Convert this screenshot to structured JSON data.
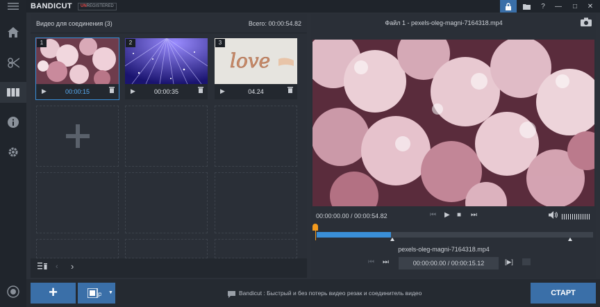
{
  "app": {
    "logo": "BANDICUT",
    "badge_prefix": "UN",
    "badge_rest": "REGISTERED"
  },
  "titlebar": {
    "buttons": [
      "lock-icon",
      "folder-icon",
      "help-icon",
      "minimize-icon",
      "maximize-icon",
      "close-icon"
    ],
    "help_label": "?",
    "minimize_label": "—",
    "maximize_label": "□",
    "close_label": "✕"
  },
  "sidebar": {
    "items": [
      "home-icon",
      "cut-icon",
      "join-icon",
      "info-icon",
      "settings-icon"
    ],
    "bottom": "record-icon"
  },
  "join_panel": {
    "title": "Видео для соединения (3)",
    "total": "Всего: 00:00:54.82",
    "clips": [
      {
        "num": "1",
        "time": "00:00:15",
        "selected": true
      },
      {
        "num": "2",
        "time": "00:00:35",
        "selected": false
      },
      {
        "num": "3",
        "time": "04.24",
        "selected": false
      }
    ],
    "thumb3_text": "love",
    "play_glyph": "▶",
    "delete_glyph": "🗑",
    "prev_glyph": "‹",
    "next_glyph": "›",
    "list_glyph": "☰"
  },
  "preview": {
    "file_title": "Файл 1 - pexels-oleg-magni-7164318.mp4",
    "time": "00:00:00.00 / 00:00:54.82",
    "segment_name": "pexels-oleg-magni-7164318.mp4",
    "segment_time": "00:00:00.00 / 00:00:15.12",
    "ctrl_prev": "⏮",
    "ctrl_play": "▶",
    "ctrl_stop": "■",
    "ctrl_next": "⏭",
    "vol_glyph": "🔊",
    "seg_prev": "⏮",
    "seg_next": "⏭",
    "seg_frame": "[▶]",
    "segment_fill": 0.27,
    "volume_level": 1.0
  },
  "bottom": {
    "add_label": "+",
    "mode_label": "▼",
    "info_text": "Bandicut : Быстрый и без потерь видео резак и соединитель видео",
    "start_label": "СТАРТ"
  },
  "colors": {
    "accent": "#3a6fa8",
    "selection": "#3a8fd8",
    "marker": "#f39a1d",
    "unregistered": "#e04a4a"
  }
}
